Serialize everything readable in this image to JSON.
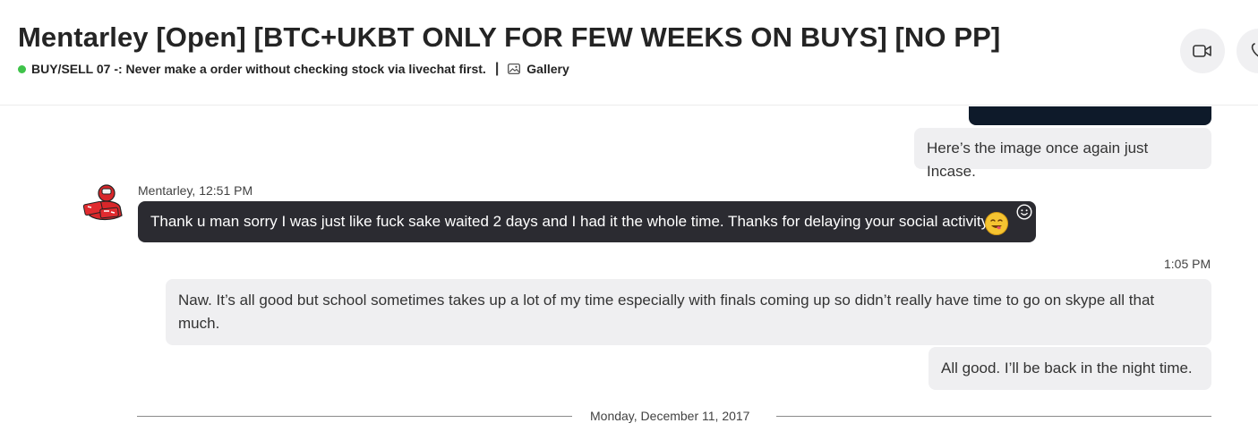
{
  "header": {
    "title": "Mentarley [Open] [BTC+UKBT ONLY FOR FEW WEEKS ON BUYS] [NO PP]",
    "status_color": "#3fc34a",
    "status_text": "BUY/SELL 07 -: Never make a order without checking stock via livechat first.",
    "separator": "|",
    "gallery_label": "Gallery",
    "icons": [
      "image-icon",
      "video-call-icon",
      "phone-call-icon"
    ]
  },
  "messages": [
    {
      "direction": "outgoing",
      "text": "Here’s the image once again just Incase."
    },
    {
      "direction": "incoming",
      "sender_line": "Mentarley, 12:51 PM",
      "text": "Thank u man sorry I was just like fuck sake waited 2 days and I had it the whole time. Thanks for delaying your social activitys",
      "emoji": "yum-face-emoji"
    },
    {
      "direction": "outgoing",
      "timestamp": "1:05 PM",
      "text": "Naw. It’s all good but school sometimes takes up a lot of my time especially with finals coming up so didn’t really have time to go on skype all that much."
    },
    {
      "direction": "outgoing",
      "text": "All good. I’ll be back in the night time."
    }
  ],
  "date_divider": "Monday, December 11, 2017",
  "colors": {
    "incoming_bubble": "#2b2b31",
    "outgoing_bubble": "#efeff1"
  }
}
